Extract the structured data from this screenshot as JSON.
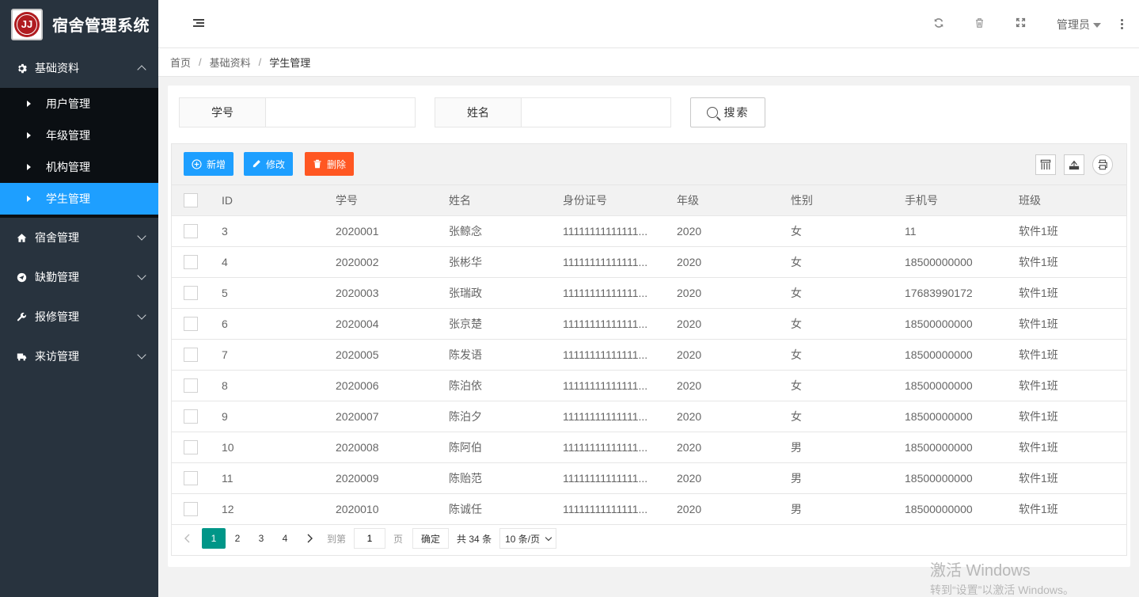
{
  "app": {
    "title": "宿舍管理系统",
    "logo_text": "JJ"
  },
  "sidebar": {
    "groups": [
      {
        "label": "基础资料",
        "icon": "gear-icon",
        "open": true
      },
      {
        "label": "宿舍管理",
        "icon": "home-icon"
      },
      {
        "label": "缺勤管理",
        "icon": "send-icon"
      },
      {
        "label": "报修管理",
        "icon": "wrench-icon"
      },
      {
        "label": "来访管理",
        "icon": "truck-icon"
      }
    ],
    "sub_items": [
      {
        "label": "用户管理"
      },
      {
        "label": "年级管理"
      },
      {
        "label": "机构管理"
      },
      {
        "label": "学生管理",
        "active": true
      }
    ]
  },
  "header": {
    "icons": [
      "refresh-icon",
      "trash-icon",
      "fullscreen-icon"
    ],
    "user": "管理员"
  },
  "breadcrumb": {
    "home": "首页",
    "section": "基础资料",
    "current": "学生管理"
  },
  "search": {
    "student_no_label": "学号",
    "student_no_value": "",
    "name_label": "姓名",
    "name_value": "",
    "button_label": "搜索"
  },
  "toolbar": {
    "add_label": "新增",
    "edit_label": "修改",
    "delete_label": "删除",
    "colors": {
      "blue": "#1e9fff",
      "red": "#ff5722",
      "green": "#009688"
    }
  },
  "table": {
    "columns": [
      "ID",
      "学号",
      "姓名",
      "身份证号",
      "年级",
      "性别",
      "手机号",
      "班级"
    ],
    "rows": [
      [
        "3",
        "2020001",
        "张鲸念",
        "11111111111111...",
        "2020",
        "女",
        "11",
        "软件1班"
      ],
      [
        "4",
        "2020002",
        "张彬华",
        "11111111111111...",
        "2020",
        "女",
        "18500000000",
        "软件1班"
      ],
      [
        "5",
        "2020003",
        "张瑞政",
        "11111111111111...",
        "2020",
        "女",
        "17683990172",
        "软件1班"
      ],
      [
        "6",
        "2020004",
        "张京楚",
        "11111111111111...",
        "2020",
        "女",
        "18500000000",
        "软件1班"
      ],
      [
        "7",
        "2020005",
        "陈发语",
        "11111111111111...",
        "2020",
        "女",
        "18500000000",
        "软件1班"
      ],
      [
        "8",
        "2020006",
        "陈泊依",
        "11111111111111...",
        "2020",
        "女",
        "18500000000",
        "软件1班"
      ],
      [
        "9",
        "2020007",
        "陈泊夕",
        "11111111111111...",
        "2020",
        "女",
        "18500000000",
        "软件1班"
      ],
      [
        "10",
        "2020008",
        "陈阿伯",
        "11111111111111...",
        "2020",
        "男",
        "18500000000",
        "软件1班"
      ],
      [
        "11",
        "2020009",
        "陈贻范",
        "11111111111111...",
        "2020",
        "男",
        "18500000000",
        "软件1班"
      ],
      [
        "12",
        "2020010",
        "陈诚任",
        "11111111111111...",
        "2020",
        "男",
        "18500000000",
        "软件1班"
      ]
    ]
  },
  "pager": {
    "pages": [
      "1",
      "2",
      "3",
      "4"
    ],
    "current": "1",
    "goto_prefix": "到第",
    "goto_value": "1",
    "goto_suffix": "页",
    "ok_label": "确定",
    "total_text": "共 34 条",
    "page_size": "10 条/页"
  },
  "watermark": {
    "line1": "激活 Windows",
    "line2": "转到“设置”以激活 Windows。"
  }
}
